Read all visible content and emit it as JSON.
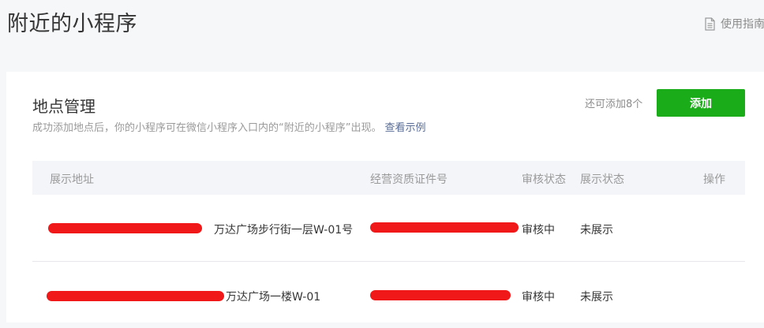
{
  "header": {
    "title": "附近的小程序",
    "guide_label": "使用指南"
  },
  "section": {
    "title": "地点管理",
    "description": "成功添加地点后，你的小程序可在微信小程序入口内的“附近的小程序”出现。",
    "example_link": "查看示例",
    "remaining": "还可添加8个",
    "add_label": "添加"
  },
  "table": {
    "columns": [
      "展示地址",
      "经营资质证件号",
      "审核状态",
      "展示状态",
      "操作"
    ],
    "rows": [
      {
        "address": "万达广场步行街一层W-01号",
        "license": "",
        "audit_status": "审核中",
        "display_status": "未展示"
      },
      {
        "address": "万达广场一楼W-01",
        "license": "",
        "audit_status": "审核中",
        "display_status": "未展示"
      }
    ]
  },
  "colors": {
    "primary_green": "#1aad19",
    "link_blue": "#576b95",
    "redaction_red": "#f01818"
  }
}
